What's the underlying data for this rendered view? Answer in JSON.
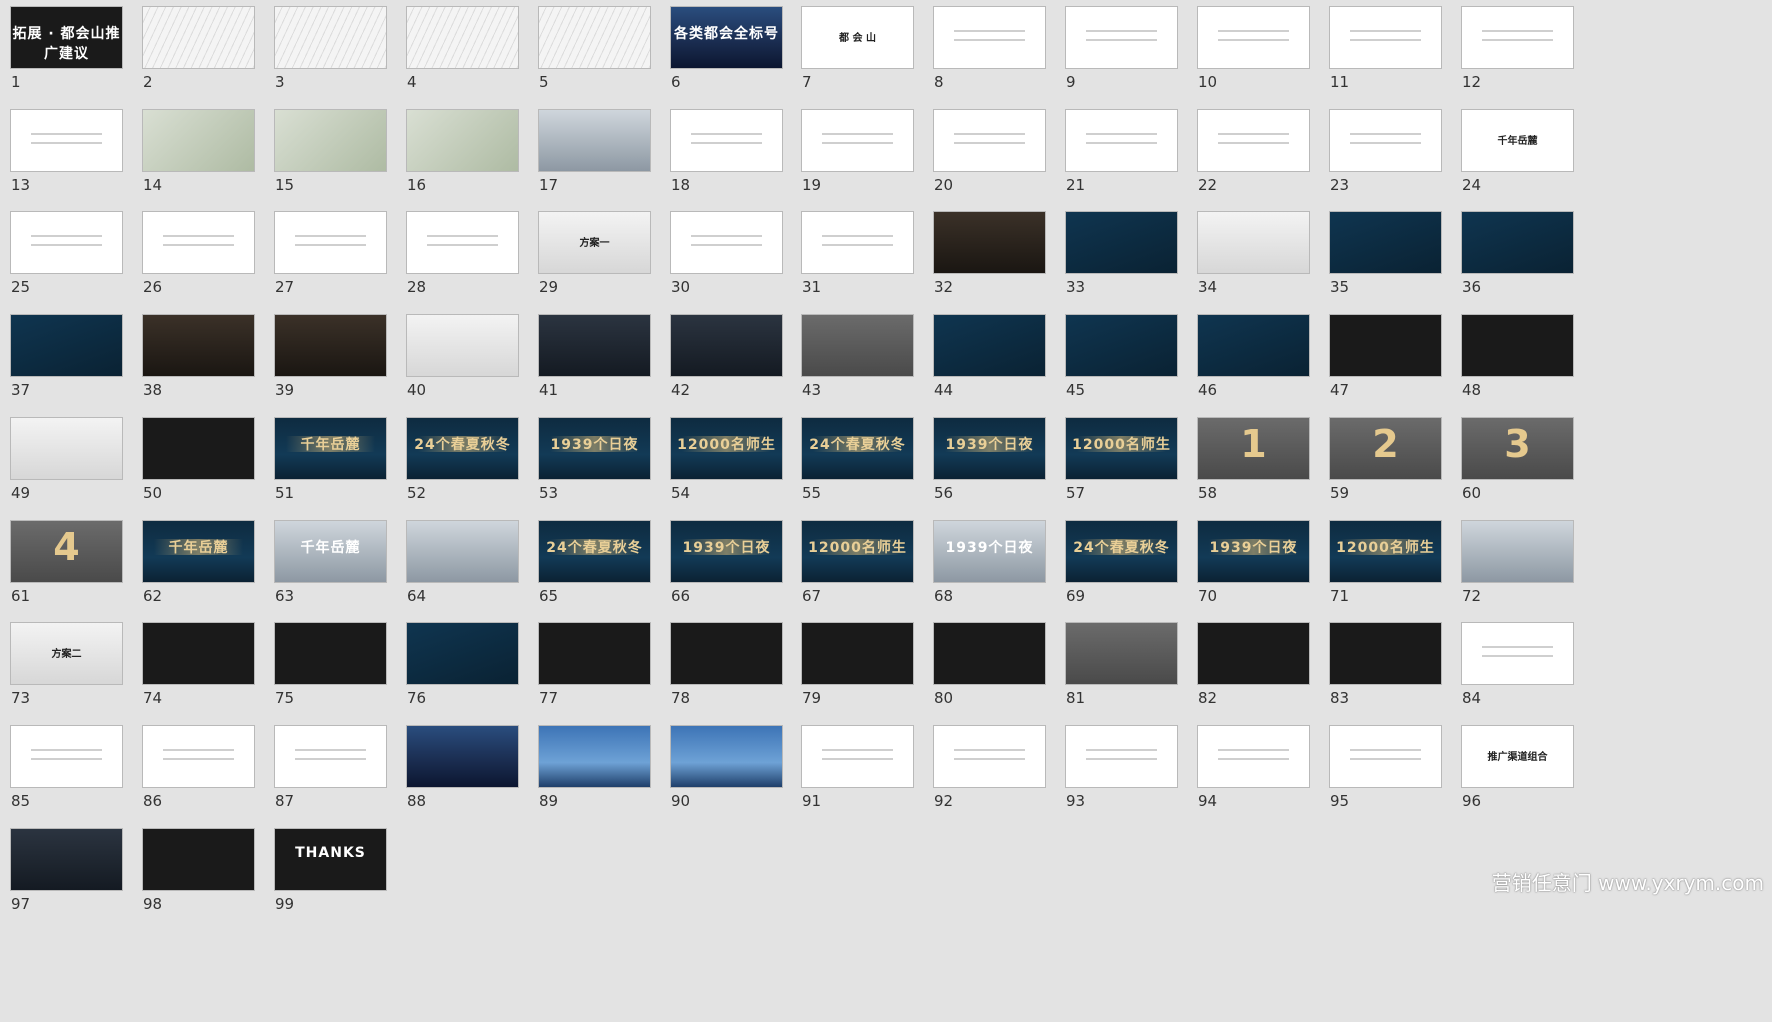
{
  "slides": [
    {
      "n": "1",
      "k": "th-dark",
      "t": "拓展 · 都会山推广建议"
    },
    {
      "n": "2",
      "k": "th-sketch",
      "t": ""
    },
    {
      "n": "3",
      "k": "th-sketch",
      "t": ""
    },
    {
      "n": "4",
      "k": "th-sketch",
      "t": ""
    },
    {
      "n": "5",
      "k": "th-sketch",
      "t": ""
    },
    {
      "n": "6",
      "k": "th-night",
      "t": "各类都会全标号"
    },
    {
      "n": "7",
      "k": "th-white",
      "t": "都 会 山"
    },
    {
      "n": "8",
      "k": "th-white",
      "t": ""
    },
    {
      "n": "9",
      "k": "th-white",
      "t": ""
    },
    {
      "n": "10",
      "k": "th-white",
      "t": ""
    },
    {
      "n": "11",
      "k": "th-white",
      "t": ""
    },
    {
      "n": "12",
      "k": "th-white",
      "t": ""
    },
    {
      "n": "13",
      "k": "th-white",
      "t": ""
    },
    {
      "n": "14",
      "k": "th-map",
      "t": ""
    },
    {
      "n": "15",
      "k": "th-map",
      "t": ""
    },
    {
      "n": "16",
      "k": "th-map",
      "t": ""
    },
    {
      "n": "17",
      "k": "th-lightphoto",
      "t": ""
    },
    {
      "n": "18",
      "k": "th-white",
      "t": ""
    },
    {
      "n": "19",
      "k": "th-white",
      "t": ""
    },
    {
      "n": "20",
      "k": "th-white",
      "t": ""
    },
    {
      "n": "21",
      "k": "th-white",
      "t": ""
    },
    {
      "n": "22",
      "k": "th-white",
      "t": ""
    },
    {
      "n": "23",
      "k": "th-white",
      "t": ""
    },
    {
      "n": "24",
      "k": "th-white",
      "t": "千年岳麓"
    },
    {
      "n": "25",
      "k": "th-white",
      "t": ""
    },
    {
      "n": "26",
      "k": "th-white",
      "t": ""
    },
    {
      "n": "27",
      "k": "th-white",
      "t": ""
    },
    {
      "n": "28",
      "k": "th-white",
      "t": ""
    },
    {
      "n": "29",
      "k": "th-light",
      "t": "方案一"
    },
    {
      "n": "30",
      "k": "th-white",
      "t": ""
    },
    {
      "n": "31",
      "k": "th-white",
      "t": ""
    },
    {
      "n": "32",
      "k": "th-room",
      "t": ""
    },
    {
      "n": "33",
      "k": "th-navy",
      "t": ""
    },
    {
      "n": "34",
      "k": "th-light",
      "t": ""
    },
    {
      "n": "35",
      "k": "th-navy",
      "t": ""
    },
    {
      "n": "36",
      "k": "th-navy",
      "t": ""
    },
    {
      "n": "37",
      "k": "th-navy",
      "t": ""
    },
    {
      "n": "38",
      "k": "th-room",
      "t": ""
    },
    {
      "n": "39",
      "k": "th-room",
      "t": ""
    },
    {
      "n": "40",
      "k": "th-light",
      "t": ""
    },
    {
      "n": "41",
      "k": "th-photo",
      "t": ""
    },
    {
      "n": "42",
      "k": "th-photo",
      "t": ""
    },
    {
      "n": "43",
      "k": "th-gray",
      "t": ""
    },
    {
      "n": "44",
      "k": "th-navy",
      "t": ""
    },
    {
      "n": "45",
      "k": "th-navy",
      "t": ""
    },
    {
      "n": "46",
      "k": "th-navy",
      "t": ""
    },
    {
      "n": "47",
      "k": "th-dark",
      "t": ""
    },
    {
      "n": "48",
      "k": "th-dark",
      "t": ""
    },
    {
      "n": "49",
      "k": "th-light",
      "t": ""
    },
    {
      "n": "50",
      "k": "th-dark",
      "t": ""
    },
    {
      "n": "51",
      "k": "th-banner",
      "t": "千年岳麓"
    },
    {
      "n": "52",
      "k": "th-banner",
      "t": "24个春夏秋冬"
    },
    {
      "n": "53",
      "k": "th-banner",
      "t": "1939个日夜"
    },
    {
      "n": "54",
      "k": "th-banner",
      "t": "12000名师生"
    },
    {
      "n": "55",
      "k": "th-banner",
      "t": "24个春夏秋冬"
    },
    {
      "n": "56",
      "k": "th-banner",
      "t": "1939个日夜"
    },
    {
      "n": "57",
      "k": "th-banner",
      "t": "12000名师生"
    },
    {
      "n": "58",
      "k": "th-gray",
      "t": "1"
    },
    {
      "n": "59",
      "k": "th-gray",
      "t": "2"
    },
    {
      "n": "60",
      "k": "th-gray",
      "t": "3"
    },
    {
      "n": "61",
      "k": "th-gray",
      "t": "4"
    },
    {
      "n": "62",
      "k": "th-banner",
      "t": "千年岳麓"
    },
    {
      "n": "63",
      "k": "th-lightphoto",
      "t": "千年岳麓"
    },
    {
      "n": "64",
      "k": "th-lightphoto",
      "t": ""
    },
    {
      "n": "65",
      "k": "th-banner",
      "t": "24个春夏秋冬"
    },
    {
      "n": "66",
      "k": "th-banner",
      "t": "1939个日夜"
    },
    {
      "n": "67",
      "k": "th-banner",
      "t": "12000名师生"
    },
    {
      "n": "68",
      "k": "th-lightphoto",
      "t": "1939个日夜"
    },
    {
      "n": "69",
      "k": "th-banner",
      "t": "24个春夏秋冬"
    },
    {
      "n": "70",
      "k": "th-banner",
      "t": "1939个日夜"
    },
    {
      "n": "71",
      "k": "th-banner",
      "t": "12000名师生"
    },
    {
      "n": "72",
      "k": "th-lightphoto",
      "t": ""
    },
    {
      "n": "73",
      "k": "th-light",
      "t": "方案二"
    },
    {
      "n": "74",
      "k": "th-dark",
      "t": ""
    },
    {
      "n": "75",
      "k": "th-dark",
      "t": ""
    },
    {
      "n": "76",
      "k": "th-navy",
      "t": ""
    },
    {
      "n": "77",
      "k": "th-dark",
      "t": ""
    },
    {
      "n": "78",
      "k": "th-dark",
      "t": ""
    },
    {
      "n": "79",
      "k": "th-dark",
      "t": ""
    },
    {
      "n": "80",
      "k": "th-dark",
      "t": ""
    },
    {
      "n": "81",
      "k": "th-gray",
      "t": ""
    },
    {
      "n": "82",
      "k": "th-dark",
      "t": ""
    },
    {
      "n": "83",
      "k": "th-dark",
      "t": ""
    },
    {
      "n": "84",
      "k": "th-white",
      "t": ""
    },
    {
      "n": "85",
      "k": "th-white",
      "t": ""
    },
    {
      "n": "86",
      "k": "th-white",
      "t": ""
    },
    {
      "n": "87",
      "k": "th-white",
      "t": ""
    },
    {
      "n": "88",
      "k": "th-night",
      "t": ""
    },
    {
      "n": "89",
      "k": "th-sky",
      "t": ""
    },
    {
      "n": "90",
      "k": "th-sky",
      "t": ""
    },
    {
      "n": "91",
      "k": "th-white",
      "t": ""
    },
    {
      "n": "92",
      "k": "th-white",
      "t": ""
    },
    {
      "n": "93",
      "k": "th-white",
      "t": ""
    },
    {
      "n": "94",
      "k": "th-white",
      "t": ""
    },
    {
      "n": "95",
      "k": "th-white",
      "t": ""
    },
    {
      "n": "96",
      "k": "th-white",
      "t": "推广渠道组合"
    },
    {
      "n": "97",
      "k": "th-photo",
      "t": ""
    },
    {
      "n": "98",
      "k": "th-dark",
      "t": ""
    },
    {
      "n": "99",
      "k": "th-dark",
      "t": "THANKS"
    }
  ],
  "watermark": "营销任意门 www.yxrym.com"
}
